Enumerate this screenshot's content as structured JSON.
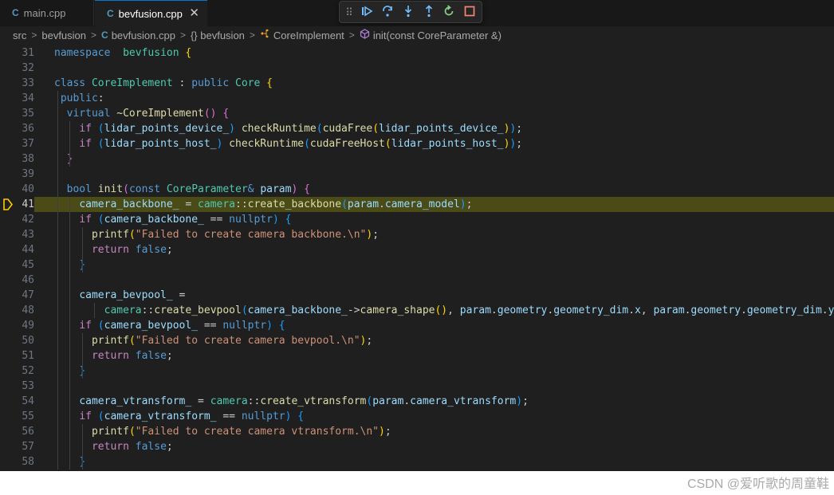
{
  "tabs": [
    {
      "label": "main.cpp",
      "icon": "C"
    },
    {
      "label": "bevfusion.cpp",
      "icon": "C"
    }
  ],
  "breadcrumb": [
    "src",
    "bevfusion",
    "bevfusion.cpp",
    "{} bevfusion",
    "CoreImplement",
    "init(const CoreParameter &)"
  ],
  "debug_toolbar": [
    "continue",
    "step-over",
    "step-into",
    "step-out",
    "restart",
    "stop"
  ],
  "active_line": 41,
  "code_lines": [
    {
      "n": "31",
      "segs": [
        [
          "kw",
          "namespace"
        ],
        [
          "",
          "  "
        ],
        [
          "ty",
          "bevfusion"
        ],
        [
          "",
          ""
        ],
        [
          "p1",
          " {"
        ]
      ]
    },
    {
      "n": "32",
      "segs": []
    },
    {
      "n": "33",
      "segs": [
        [
          "kw",
          "class"
        ],
        [
          "",
          " "
        ],
        [
          "ty",
          "CoreImplement"
        ],
        [
          "",
          " : "
        ],
        [
          "kw",
          "public"
        ],
        [
          "",
          " "
        ],
        [
          "ty",
          "Core"
        ],
        [
          "p1",
          " {"
        ]
      ]
    },
    {
      "n": "34",
      "segs": [
        [
          "",
          " "
        ],
        [
          "kw",
          "public"
        ],
        [
          "",
          ":"
        ]
      ]
    },
    {
      "n": "35",
      "segs": [
        [
          "",
          "  "
        ],
        [
          "kw",
          "virtual"
        ],
        [
          "",
          " "
        ],
        [
          "fn",
          "~CoreImplement"
        ],
        [
          "p2",
          "()"
        ],
        [
          "",
          " "
        ],
        [
          "p2",
          "{"
        ]
      ]
    },
    {
      "n": "36",
      "segs": [
        [
          "",
          "    "
        ],
        [
          "ctl",
          "if"
        ],
        [
          "",
          " "
        ],
        [
          "p3",
          "("
        ],
        [
          "va",
          "lidar_points_device_"
        ],
        [
          "p3",
          ")"
        ],
        [
          "",
          " "
        ],
        [
          "fn",
          "checkRuntime"
        ],
        [
          "p3",
          "("
        ],
        [
          "fn",
          "cudaFree"
        ],
        [
          "p1",
          "("
        ],
        [
          "va",
          "lidar_points_device_"
        ],
        [
          "p1",
          ")"
        ],
        [
          "p3",
          ")"
        ],
        [
          "",
          ";"
        ]
      ]
    },
    {
      "n": "37",
      "segs": [
        [
          "",
          "    "
        ],
        [
          "ctl",
          "if"
        ],
        [
          "",
          " "
        ],
        [
          "p3",
          "("
        ],
        [
          "va",
          "lidar_points_host_"
        ],
        [
          "p3",
          ")"
        ],
        [
          "",
          " "
        ],
        [
          "fn",
          "checkRuntime"
        ],
        [
          "p3",
          "("
        ],
        [
          "fn",
          "cudaFreeHost"
        ],
        [
          "p1",
          "("
        ],
        [
          "va",
          "lidar_points_host_"
        ],
        [
          "p1",
          ")"
        ],
        [
          "p3",
          ")"
        ],
        [
          "",
          ";"
        ]
      ]
    },
    {
      "n": "38",
      "segs": [
        [
          "",
          "  "
        ],
        [
          "p2",
          "}"
        ]
      ]
    },
    {
      "n": "39",
      "segs": []
    },
    {
      "n": "40",
      "segs": [
        [
          "",
          "  "
        ],
        [
          "kw",
          "bool"
        ],
        [
          "",
          " "
        ],
        [
          "fn",
          "init"
        ],
        [
          "p2",
          "("
        ],
        [
          "kw",
          "const"
        ],
        [
          "",
          " "
        ],
        [
          "ty",
          "CoreParameter"
        ],
        [
          "kw",
          "&"
        ],
        [
          "",
          " "
        ],
        [
          "va",
          "param"
        ],
        [
          "p2",
          ")"
        ],
        [
          "",
          " "
        ],
        [
          "p2",
          "{"
        ]
      ]
    },
    {
      "n": "41",
      "segs": [
        [
          "",
          "    "
        ],
        [
          "va",
          "camera_backbone_"
        ],
        [
          "",
          " = "
        ],
        [
          "ty",
          "camera"
        ],
        [
          "",
          "::"
        ],
        [
          "fn",
          "create_backbone"
        ],
        [
          "p3",
          "("
        ],
        [
          "va",
          "param"
        ],
        [
          "",
          "."
        ],
        [
          "va",
          "camera_model"
        ],
        [
          "p3",
          ")"
        ],
        [
          "",
          ";"
        ]
      ]
    },
    {
      "n": "42",
      "segs": [
        [
          "",
          "    "
        ],
        [
          "ctl",
          "if"
        ],
        [
          "",
          " "
        ],
        [
          "p3",
          "("
        ],
        [
          "va",
          "camera_backbone_"
        ],
        [
          "",
          " == "
        ],
        [
          "kw",
          "nullptr"
        ],
        [
          "p3",
          ")"
        ],
        [
          "",
          " "
        ],
        [
          "p3",
          "{"
        ]
      ]
    },
    {
      "n": "43",
      "segs": [
        [
          "",
          "      "
        ],
        [
          "fn",
          "printf"
        ],
        [
          "p1",
          "("
        ],
        [
          "st",
          "\"Failed to create camera backbone.\\n\""
        ],
        [
          "p1",
          ")"
        ],
        [
          "",
          ";"
        ]
      ]
    },
    {
      "n": "44",
      "segs": [
        [
          "",
          "      "
        ],
        [
          "ctl",
          "return"
        ],
        [
          "",
          " "
        ],
        [
          "kw",
          "false"
        ],
        [
          "",
          ";"
        ]
      ]
    },
    {
      "n": "45",
      "segs": [
        [
          "",
          "    "
        ],
        [
          "p3",
          "}"
        ]
      ]
    },
    {
      "n": "46",
      "segs": []
    },
    {
      "n": "47",
      "segs": [
        [
          "",
          "    "
        ],
        [
          "va",
          "camera_bevpool_"
        ],
        [
          "",
          " ="
        ]
      ]
    },
    {
      "n": "48",
      "segs": [
        [
          "",
          "        "
        ],
        [
          "ty",
          "camera"
        ],
        [
          "",
          "::"
        ],
        [
          "fn",
          "create_bevpool"
        ],
        [
          "p3",
          "("
        ],
        [
          "va",
          "camera_backbone_"
        ],
        [
          "",
          "->"
        ],
        [
          "fn",
          "camera_shape"
        ],
        [
          "p1",
          "()"
        ],
        [
          "",
          ", "
        ],
        [
          "va",
          "param"
        ],
        [
          "",
          "."
        ],
        [
          "va",
          "geometry"
        ],
        [
          "",
          "."
        ],
        [
          "va",
          "geometry_dim"
        ],
        [
          "",
          "."
        ],
        [
          "va",
          "x"
        ],
        [
          "",
          ", "
        ],
        [
          "va",
          "param"
        ],
        [
          "",
          "."
        ],
        [
          "va",
          "geometry"
        ],
        [
          "",
          "."
        ],
        [
          "va",
          "geometry_dim"
        ],
        [
          "",
          "."
        ],
        [
          "va",
          "y"
        ],
        [
          "p3",
          ")"
        ],
        [
          "",
          ";"
        ]
      ]
    },
    {
      "n": "49",
      "segs": [
        [
          "",
          "    "
        ],
        [
          "ctl",
          "if"
        ],
        [
          "",
          " "
        ],
        [
          "p3",
          "("
        ],
        [
          "va",
          "camera_bevpool_"
        ],
        [
          "",
          " == "
        ],
        [
          "kw",
          "nullptr"
        ],
        [
          "p3",
          ")"
        ],
        [
          "",
          " "
        ],
        [
          "p3",
          "{"
        ]
      ]
    },
    {
      "n": "50",
      "segs": [
        [
          "",
          "      "
        ],
        [
          "fn",
          "printf"
        ],
        [
          "p1",
          "("
        ],
        [
          "st",
          "\"Failed to create camera bevpool.\\n\""
        ],
        [
          "p1",
          ")"
        ],
        [
          "",
          ";"
        ]
      ]
    },
    {
      "n": "51",
      "segs": [
        [
          "",
          "      "
        ],
        [
          "ctl",
          "return"
        ],
        [
          "",
          " "
        ],
        [
          "kw",
          "false"
        ],
        [
          "",
          ";"
        ]
      ]
    },
    {
      "n": "52",
      "segs": [
        [
          "",
          "    "
        ],
        [
          "p3",
          "}"
        ]
      ]
    },
    {
      "n": "53",
      "segs": []
    },
    {
      "n": "54",
      "segs": [
        [
          "",
          "    "
        ],
        [
          "va",
          "camera_vtransform_"
        ],
        [
          "",
          " = "
        ],
        [
          "ty",
          "camera"
        ],
        [
          "",
          "::"
        ],
        [
          "fn",
          "create_vtransform"
        ],
        [
          "p3",
          "("
        ],
        [
          "va",
          "param"
        ],
        [
          "",
          "."
        ],
        [
          "va",
          "camera_vtransform"
        ],
        [
          "p3",
          ")"
        ],
        [
          "",
          ";"
        ]
      ]
    },
    {
      "n": "55",
      "segs": [
        [
          "",
          "    "
        ],
        [
          "ctl",
          "if"
        ],
        [
          "",
          " "
        ],
        [
          "p3",
          "("
        ],
        [
          "va",
          "camera_vtransform_"
        ],
        [
          "",
          " == "
        ],
        [
          "kw",
          "nullptr"
        ],
        [
          "p3",
          ")"
        ],
        [
          "",
          " "
        ],
        [
          "p3",
          "{"
        ]
      ]
    },
    {
      "n": "56",
      "segs": [
        [
          "",
          "      "
        ],
        [
          "fn",
          "printf"
        ],
        [
          "p1",
          "("
        ],
        [
          "st",
          "\"Failed to create camera vtransform.\\n\""
        ],
        [
          "p1",
          ")"
        ],
        [
          "",
          ";"
        ]
      ]
    },
    {
      "n": "57",
      "segs": [
        [
          "",
          "      "
        ],
        [
          "ctl",
          "return"
        ],
        [
          "",
          " "
        ],
        [
          "kw",
          "false"
        ],
        [
          "",
          ";"
        ]
      ]
    },
    {
      "n": "58",
      "segs": [
        [
          "",
          "    "
        ],
        [
          "p3",
          "}"
        ]
      ]
    }
  ],
  "watermark": "CSDN @爱听歌的周童鞋"
}
